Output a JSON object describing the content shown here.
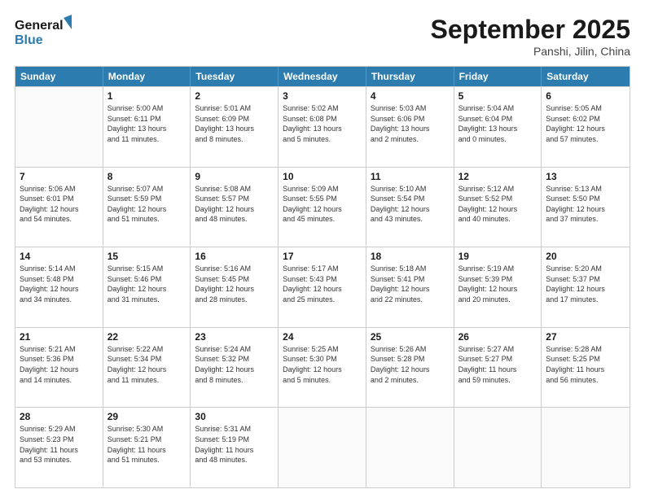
{
  "header": {
    "logo_general": "General",
    "logo_blue": "Blue",
    "month_title": "September 2025",
    "location": "Panshi, Jilin, China"
  },
  "days_of_week": [
    "Sunday",
    "Monday",
    "Tuesday",
    "Wednesday",
    "Thursday",
    "Friday",
    "Saturday"
  ],
  "weeks": [
    [
      {
        "day": "",
        "info": ""
      },
      {
        "day": "1",
        "info": "Sunrise: 5:00 AM\nSunset: 6:11 PM\nDaylight: 13 hours\nand 11 minutes."
      },
      {
        "day": "2",
        "info": "Sunrise: 5:01 AM\nSunset: 6:09 PM\nDaylight: 13 hours\nand 8 minutes."
      },
      {
        "day": "3",
        "info": "Sunrise: 5:02 AM\nSunset: 6:08 PM\nDaylight: 13 hours\nand 5 minutes."
      },
      {
        "day": "4",
        "info": "Sunrise: 5:03 AM\nSunset: 6:06 PM\nDaylight: 13 hours\nand 2 minutes."
      },
      {
        "day": "5",
        "info": "Sunrise: 5:04 AM\nSunset: 6:04 PM\nDaylight: 13 hours\nand 0 minutes."
      },
      {
        "day": "6",
        "info": "Sunrise: 5:05 AM\nSunset: 6:02 PM\nDaylight: 12 hours\nand 57 minutes."
      }
    ],
    [
      {
        "day": "7",
        "info": "Sunrise: 5:06 AM\nSunset: 6:01 PM\nDaylight: 12 hours\nand 54 minutes."
      },
      {
        "day": "8",
        "info": "Sunrise: 5:07 AM\nSunset: 5:59 PM\nDaylight: 12 hours\nand 51 minutes."
      },
      {
        "day": "9",
        "info": "Sunrise: 5:08 AM\nSunset: 5:57 PM\nDaylight: 12 hours\nand 48 minutes."
      },
      {
        "day": "10",
        "info": "Sunrise: 5:09 AM\nSunset: 5:55 PM\nDaylight: 12 hours\nand 45 minutes."
      },
      {
        "day": "11",
        "info": "Sunrise: 5:10 AM\nSunset: 5:54 PM\nDaylight: 12 hours\nand 43 minutes."
      },
      {
        "day": "12",
        "info": "Sunrise: 5:12 AM\nSunset: 5:52 PM\nDaylight: 12 hours\nand 40 minutes."
      },
      {
        "day": "13",
        "info": "Sunrise: 5:13 AM\nSunset: 5:50 PM\nDaylight: 12 hours\nand 37 minutes."
      }
    ],
    [
      {
        "day": "14",
        "info": "Sunrise: 5:14 AM\nSunset: 5:48 PM\nDaylight: 12 hours\nand 34 minutes."
      },
      {
        "day": "15",
        "info": "Sunrise: 5:15 AM\nSunset: 5:46 PM\nDaylight: 12 hours\nand 31 minutes."
      },
      {
        "day": "16",
        "info": "Sunrise: 5:16 AM\nSunset: 5:45 PM\nDaylight: 12 hours\nand 28 minutes."
      },
      {
        "day": "17",
        "info": "Sunrise: 5:17 AM\nSunset: 5:43 PM\nDaylight: 12 hours\nand 25 minutes."
      },
      {
        "day": "18",
        "info": "Sunrise: 5:18 AM\nSunset: 5:41 PM\nDaylight: 12 hours\nand 22 minutes."
      },
      {
        "day": "19",
        "info": "Sunrise: 5:19 AM\nSunset: 5:39 PM\nDaylight: 12 hours\nand 20 minutes."
      },
      {
        "day": "20",
        "info": "Sunrise: 5:20 AM\nSunset: 5:37 PM\nDaylight: 12 hours\nand 17 minutes."
      }
    ],
    [
      {
        "day": "21",
        "info": "Sunrise: 5:21 AM\nSunset: 5:36 PM\nDaylight: 12 hours\nand 14 minutes."
      },
      {
        "day": "22",
        "info": "Sunrise: 5:22 AM\nSunset: 5:34 PM\nDaylight: 12 hours\nand 11 minutes."
      },
      {
        "day": "23",
        "info": "Sunrise: 5:24 AM\nSunset: 5:32 PM\nDaylight: 12 hours\nand 8 minutes."
      },
      {
        "day": "24",
        "info": "Sunrise: 5:25 AM\nSunset: 5:30 PM\nDaylight: 12 hours\nand 5 minutes."
      },
      {
        "day": "25",
        "info": "Sunrise: 5:26 AM\nSunset: 5:28 PM\nDaylight: 12 hours\nand 2 minutes."
      },
      {
        "day": "26",
        "info": "Sunrise: 5:27 AM\nSunset: 5:27 PM\nDaylight: 11 hours\nand 59 minutes."
      },
      {
        "day": "27",
        "info": "Sunrise: 5:28 AM\nSunset: 5:25 PM\nDaylight: 11 hours\nand 56 minutes."
      }
    ],
    [
      {
        "day": "28",
        "info": "Sunrise: 5:29 AM\nSunset: 5:23 PM\nDaylight: 11 hours\nand 53 minutes."
      },
      {
        "day": "29",
        "info": "Sunrise: 5:30 AM\nSunset: 5:21 PM\nDaylight: 11 hours\nand 51 minutes."
      },
      {
        "day": "30",
        "info": "Sunrise: 5:31 AM\nSunset: 5:19 PM\nDaylight: 11 hours\nand 48 minutes."
      },
      {
        "day": "",
        "info": ""
      },
      {
        "day": "",
        "info": ""
      },
      {
        "day": "",
        "info": ""
      },
      {
        "day": "",
        "info": ""
      }
    ]
  ]
}
